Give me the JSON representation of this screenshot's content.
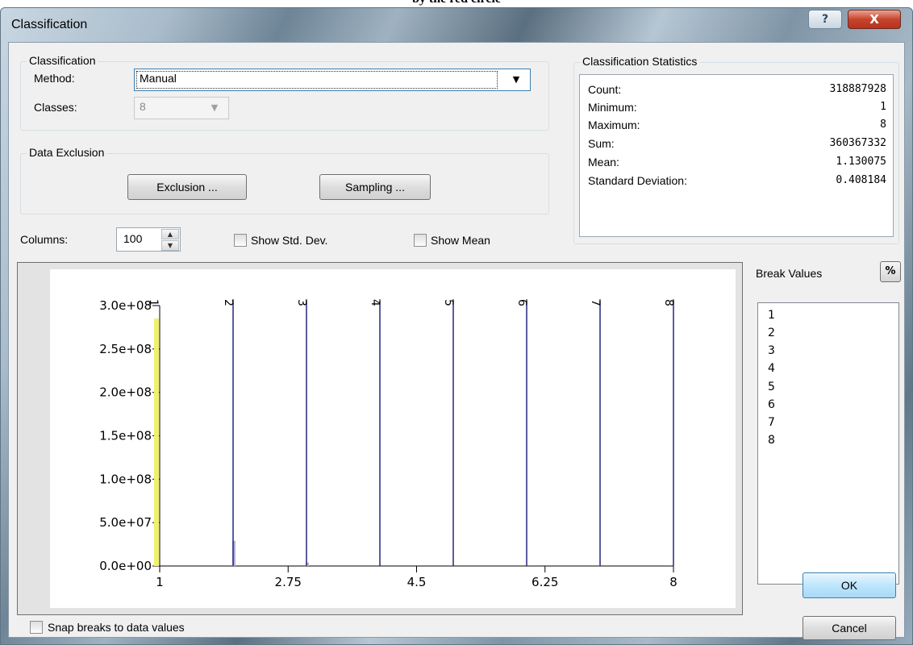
{
  "caption": "by the red circle",
  "window": {
    "title": "Classification",
    "help_label": "?",
    "close_label": "X"
  },
  "classification_group": {
    "legend": "Classification",
    "method_label": "Method:",
    "method_value": "Manual",
    "classes_label": "Classes:",
    "classes_value": "8"
  },
  "data_exclusion": {
    "legend": "Data Exclusion",
    "exclusion_button": "Exclusion ...",
    "sampling_button": "Sampling ..."
  },
  "statistics": {
    "legend": "Classification Statistics",
    "rows": [
      {
        "label": "Count:",
        "value": "318887928"
      },
      {
        "label": "Minimum:",
        "value": "1"
      },
      {
        "label": "Maximum:",
        "value": "8"
      },
      {
        "label": "Sum:",
        "value": "360367332"
      },
      {
        "label": "Mean:",
        "value": "1.130075"
      },
      {
        "label": "Standard Deviation:",
        "value": "0.408184"
      }
    ]
  },
  "controls": {
    "columns_label": "Columns:",
    "columns_value": "100",
    "show_std_dev": "Show Std. Dev.",
    "show_mean": "Show Mean",
    "snap_breaks": "Snap breaks to data values"
  },
  "break_values": {
    "label": "Break Values",
    "percent_button": "%",
    "items": [
      "1",
      "2",
      "3",
      "4",
      "5",
      "6",
      "7",
      "8"
    ]
  },
  "buttons": {
    "ok": "OK",
    "cancel": "Cancel"
  },
  "colors": {
    "histogram_bar": "#b2b2dc",
    "break_line": "#262680",
    "first_break": "#f0f070"
  },
  "chart_data": {
    "type": "bar",
    "xlim": [
      1,
      8
    ],
    "ylim": [
      0,
      300000000
    ],
    "x_ticks": [
      "1",
      "2.75",
      "4.5",
      "6.25",
      "8"
    ],
    "y_ticks": [
      "0.0e+00",
      "5.0e+07",
      "1.0e+08",
      "1.5e+08",
      "2.0e+08",
      "2.5e+08",
      "3.0e+08"
    ],
    "bars": [
      {
        "x": 1,
        "value": 285000000
      },
      {
        "x": 2,
        "value": 29000000
      },
      {
        "x": 3,
        "value": 4000000
      }
    ],
    "breaks": [
      {
        "x": 1,
        "label": "1"
      },
      {
        "x": 2,
        "label": "2"
      },
      {
        "x": 3,
        "label": "3"
      },
      {
        "x": 4,
        "label": "4"
      },
      {
        "x": 5,
        "label": "5"
      },
      {
        "x": 6,
        "label": "6"
      },
      {
        "x": 7,
        "label": "7"
      },
      {
        "x": 8,
        "label": "8"
      }
    ]
  }
}
